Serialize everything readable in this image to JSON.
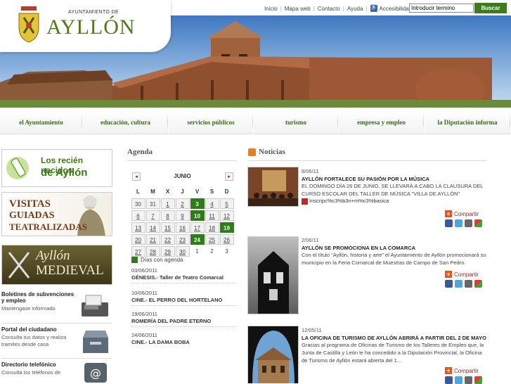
{
  "header": {
    "logo_small": "AYUNTAMIENTO DE",
    "logo_big": "AYLLÓN",
    "top_links": [
      "Inicio",
      "Mapa web",
      "Contacto",
      "Ayuda"
    ],
    "accessibility": "Accesibilidad",
    "search_placeholder": "Introducir termino",
    "search_button": "Buscar"
  },
  "nav": [
    "el Ayuntamiento",
    "educación, cultura",
    "servicios públicos",
    "turismo",
    "empresa y empleo",
    "la Diputación informa"
  ],
  "promos": {
    "babies_line1": "Los recién nacidos",
    "babies_line2": "de Ayllón",
    "visitas_1": "VISITAS",
    "visitas_2": "GUIADAS",
    "visitas_3": "TEATRALIZADAS",
    "medieval_1": "Ayllón",
    "medieval_2": "MEDIEVAL"
  },
  "sidebar_links": [
    {
      "title": "Boletines de subvenciones y empleo",
      "desc": "Mantengase informado"
    },
    {
      "title": "Portal del ciudadano",
      "desc": "Consulta tus datos y realiza tramites desde casa"
    },
    {
      "title": "Directorio telefónico",
      "desc": "Consulta los teléfonos de"
    }
  ],
  "agenda": {
    "title": "Agenda",
    "month": "JUNIO",
    "prev": "◂",
    "next": "▸",
    "weekdays": [
      "L",
      "M",
      "X",
      "J",
      "V",
      "S",
      "D"
    ],
    "legend": "Días con agenda",
    "events": [
      {
        "date": "03/06/2011",
        "title": "GÉNESIS.- Taller de Teatro Comarcal"
      },
      {
        "date": "10/06/2011",
        "title": "CINE.- EL PERRO DEL HORTELANO"
      },
      {
        "date": "19/06/2011",
        "title": "ROMERÍA DEL PADRE ETERNO"
      },
      {
        "date": "24/06/2011",
        "title": "CINE.- LA DAMA BOBA"
      }
    ]
  },
  "news": {
    "title": "Noticias",
    "share_label": "Compartir",
    "items": [
      {
        "date": "8/06/11",
        "headline": "AYLLÓN FORTALECE SU PASIÓN POR LA MÚSICA",
        "body": "EL DOMINGO DÍA 26 DE JUNIO, SE LLEVARÁ A CABO LA CLAUSURA DEL CURSO ESCOLAR DEL TALLER DE MÚSICA \"VILLA DE AYLLÓN\"",
        "attachment": "Inscripc%c3%b3n+m%c3%basica"
      },
      {
        "date": "2/06/11",
        "headline": "AYLLÓN SE PROMOCIONA EN LA COMARCA",
        "body": "Con el título \"Ayllón, historia y arte\" el Ayuntamiento de Ayllón promocionará su municipio en la Feria Comarcal de Muestras de Campo de San Pedro."
      },
      {
        "date": "12/05/11",
        "headline": "LA OFICINA DE TURISMO DE AYLLÓN ABRIRÁ A PARTIR DEL 2 DE MAYO",
        "body": "Gracias al programa de Oficinas de Turismo de los Talleres de Empleo que, la Junta de Castilla y León le ha concedido a la Diputación Provincial, la Oficina de Turismo de Ayllón estará abierta del 1..."
      }
    ]
  },
  "colors": {
    "brand_green": "#2e7d18",
    "nav_text": "#2f6d12",
    "accent_orange": "#e8541f"
  }
}
